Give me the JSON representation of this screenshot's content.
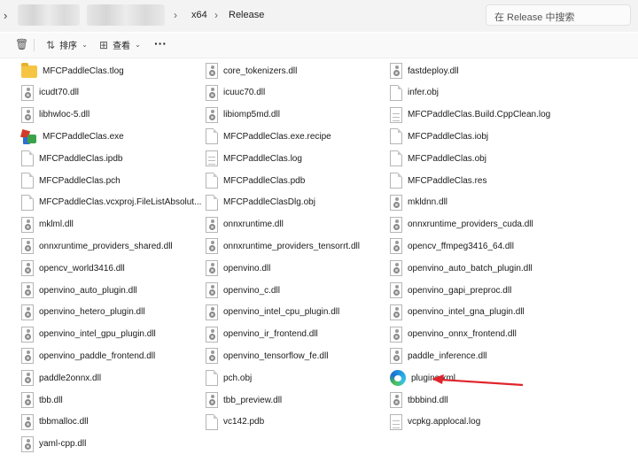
{
  "address_bar": {
    "crumbs": [
      "x64",
      "Release"
    ],
    "search_placeholder": "在 Release 中搜索"
  },
  "toolbar": {
    "sort_label": "排序",
    "view_label": "查看",
    "more_label": "···"
  },
  "colors": {
    "accent": "#1f8ddb",
    "arrow": "#e0242b",
    "folder": "#f5c542"
  },
  "files": [
    {
      "name": "MFCPaddleClas.tlog",
      "icon": "folder-icon"
    },
    {
      "name": "core_tokenizers.dll",
      "icon": "dll-icon"
    },
    {
      "name": "fastdeploy.dll",
      "icon": "dll-icon"
    },
    {
      "name": "icudt70.dll",
      "icon": "dll-icon"
    },
    {
      "name": "icuuc70.dll",
      "icon": "dll-icon"
    },
    {
      "name": "infer.obj",
      "icon": "file-icon"
    },
    {
      "name": "libhwloc-5.dll",
      "icon": "dll-icon"
    },
    {
      "name": "libiomp5md.dll",
      "icon": "dll-icon"
    },
    {
      "name": "MFCPaddleClas.Build.CppClean.log",
      "icon": "text-file-icon"
    },
    {
      "name": "MFCPaddleClas.exe",
      "icon": "exe-icon"
    },
    {
      "name": "MFCPaddleClas.exe.recipe",
      "icon": "file-icon"
    },
    {
      "name": "MFCPaddleClas.iobj",
      "icon": "file-icon"
    },
    {
      "name": "MFCPaddleClas.ipdb",
      "icon": "file-icon"
    },
    {
      "name": "MFCPaddleClas.log",
      "icon": "text-file-icon"
    },
    {
      "name": "MFCPaddleClas.obj",
      "icon": "file-icon"
    },
    {
      "name": "MFCPaddleClas.pch",
      "icon": "file-icon"
    },
    {
      "name": "MFCPaddleClas.pdb",
      "icon": "file-icon"
    },
    {
      "name": "MFCPaddleClas.res",
      "icon": "file-icon"
    },
    {
      "name": "MFCPaddleClas.vcxproj.FileListAbsolut...",
      "icon": "file-icon"
    },
    {
      "name": "MFCPaddleClasDlg.obj",
      "icon": "file-icon"
    },
    {
      "name": "mkldnn.dll",
      "icon": "dll-icon"
    },
    {
      "name": "mklml.dll",
      "icon": "dll-icon"
    },
    {
      "name": "onnxruntime.dll",
      "icon": "dll-icon"
    },
    {
      "name": "onnxruntime_providers_cuda.dll",
      "icon": "dll-icon"
    },
    {
      "name": "onnxruntime_providers_shared.dll",
      "icon": "dll-icon"
    },
    {
      "name": "onnxruntime_providers_tensorrt.dll",
      "icon": "dll-icon"
    },
    {
      "name": "opencv_ffmpeg3416_64.dll",
      "icon": "dll-icon"
    },
    {
      "name": "opencv_world3416.dll",
      "icon": "dll-icon"
    },
    {
      "name": "openvino.dll",
      "icon": "dll-icon"
    },
    {
      "name": "openvino_auto_batch_plugin.dll",
      "icon": "dll-icon"
    },
    {
      "name": "openvino_auto_plugin.dll",
      "icon": "dll-icon"
    },
    {
      "name": "openvino_c.dll",
      "icon": "dll-icon"
    },
    {
      "name": "openvino_gapi_preproc.dll",
      "icon": "dll-icon"
    },
    {
      "name": "openvino_hetero_plugin.dll",
      "icon": "dll-icon"
    },
    {
      "name": "openvino_intel_cpu_plugin.dll",
      "icon": "dll-icon"
    },
    {
      "name": "openvino_intel_gna_plugin.dll",
      "icon": "dll-icon"
    },
    {
      "name": "openvino_intel_gpu_plugin.dll",
      "icon": "dll-icon"
    },
    {
      "name": "openvino_ir_frontend.dll",
      "icon": "dll-icon"
    },
    {
      "name": "openvino_onnx_frontend.dll",
      "icon": "dll-icon"
    },
    {
      "name": "openvino_paddle_frontend.dll",
      "icon": "dll-icon"
    },
    {
      "name": "openvino_tensorflow_fe.dll",
      "icon": "dll-icon"
    },
    {
      "name": "paddle_inference.dll",
      "icon": "dll-icon"
    },
    {
      "name": "paddle2onnx.dll",
      "icon": "dll-icon"
    },
    {
      "name": "pch.obj",
      "icon": "file-icon"
    },
    {
      "name": "plugins.xml",
      "icon": "edge-icon"
    },
    {
      "name": "tbb.dll",
      "icon": "dll-icon"
    },
    {
      "name": "tbb_preview.dll",
      "icon": "dll-icon"
    },
    {
      "name": "tbbbind.dll",
      "icon": "dll-icon"
    },
    {
      "name": "tbbmalloc.dll",
      "icon": "dll-icon"
    },
    {
      "name": "vc142.pdb",
      "icon": "file-icon"
    },
    {
      "name": "vcpkg.applocal.log",
      "icon": "text-file-icon"
    },
    {
      "name": "yaml-cpp.dll",
      "icon": "dll-icon"
    }
  ]
}
